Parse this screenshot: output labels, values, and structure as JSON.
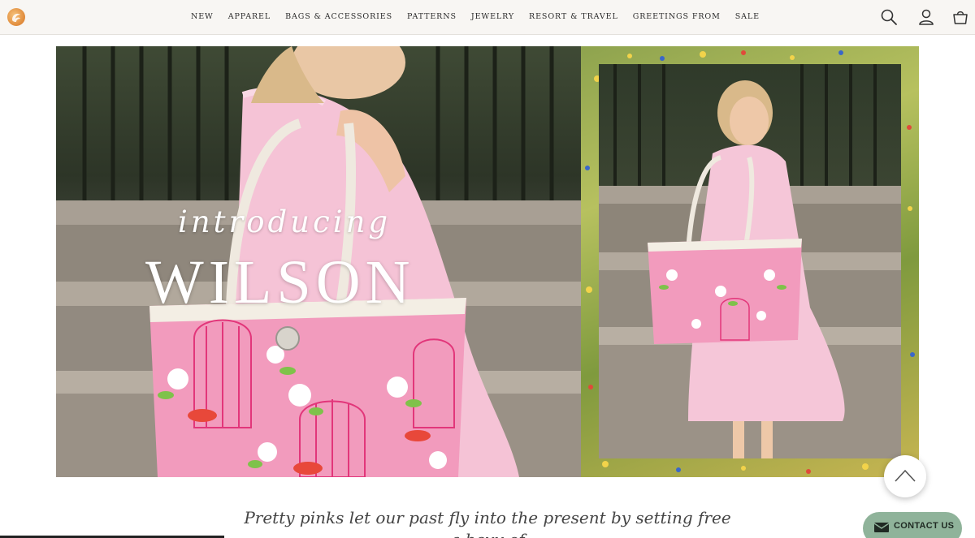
{
  "nav": {
    "items": [
      "NEW",
      "APPAREL",
      "BAGS & ACCESSORIES",
      "PATTERNS",
      "JEWELRY",
      "RESORT & TRAVEL",
      "GREETINGS FROM",
      "SALE"
    ]
  },
  "icons": {
    "logo": "brand-logo",
    "search": "search-icon",
    "account": "user-icon",
    "cart": "shopping-bag-icon",
    "scroll_top": "chevron-up-icon",
    "contact": "envelope-icon"
  },
  "hero": {
    "intro": "introducing",
    "brand": "WILSON"
  },
  "tagline": "Pretty pinks let our past fly into the present by setting free a bevy of",
  "contact": {
    "label": "CONTACT US"
  },
  "colors": {
    "header_bg": "#f8f6f3",
    "accent_pink": "#f29bbd",
    "contact_green": "#8fb39a",
    "text_dark": "#2b2b2b"
  }
}
